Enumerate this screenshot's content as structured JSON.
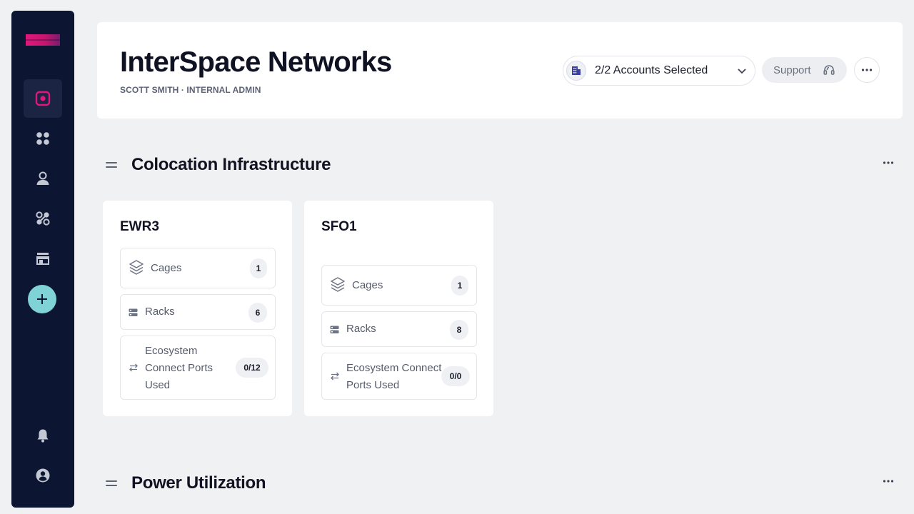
{
  "sidebar": {
    "items": [
      {
        "icon": "overview-icon",
        "active": true
      },
      {
        "icon": "apps-grid-icon",
        "active": false
      },
      {
        "icon": "user-icon",
        "active": false
      },
      {
        "icon": "connections-icon",
        "active": false
      },
      {
        "icon": "storefront-icon",
        "active": false
      }
    ],
    "add_icon": "plus-icon",
    "bottom_items": [
      {
        "icon": "bell-icon"
      },
      {
        "icon": "profile-icon"
      }
    ]
  },
  "header": {
    "org_name": "InterSpace Networks",
    "user_line": "SCOTT SMITH · INTERNAL ADMIN",
    "accounts_label": "2/2 Accounts Selected",
    "support_label": "Support"
  },
  "sections": [
    {
      "title": "Colocation Infrastructure"
    },
    {
      "title": "Power Utilization"
    }
  ],
  "sites": [
    {
      "name": "EWR3",
      "metrics": [
        {
          "label": "Cages",
          "value": "1"
        },
        {
          "label": "Racks",
          "value": "6"
        },
        {
          "label_lines": [
            "Ecosystem",
            "Connect Ports",
            "Used"
          ],
          "value": "0/12"
        }
      ]
    },
    {
      "name": "SFO1",
      "metrics": [
        {
          "label": "Cages",
          "value": "1"
        },
        {
          "label": "Racks",
          "value": "8"
        },
        {
          "label_lines": [
            "Ecosystem Connect",
            "Ports Used"
          ],
          "value": "0/0"
        }
      ]
    }
  ],
  "colors": {
    "sidebar_bg": "#0c1531",
    "brand_pink": "#e0187c",
    "add_button": "#7fd3d6",
    "page_bg": "#f0f1f3"
  }
}
